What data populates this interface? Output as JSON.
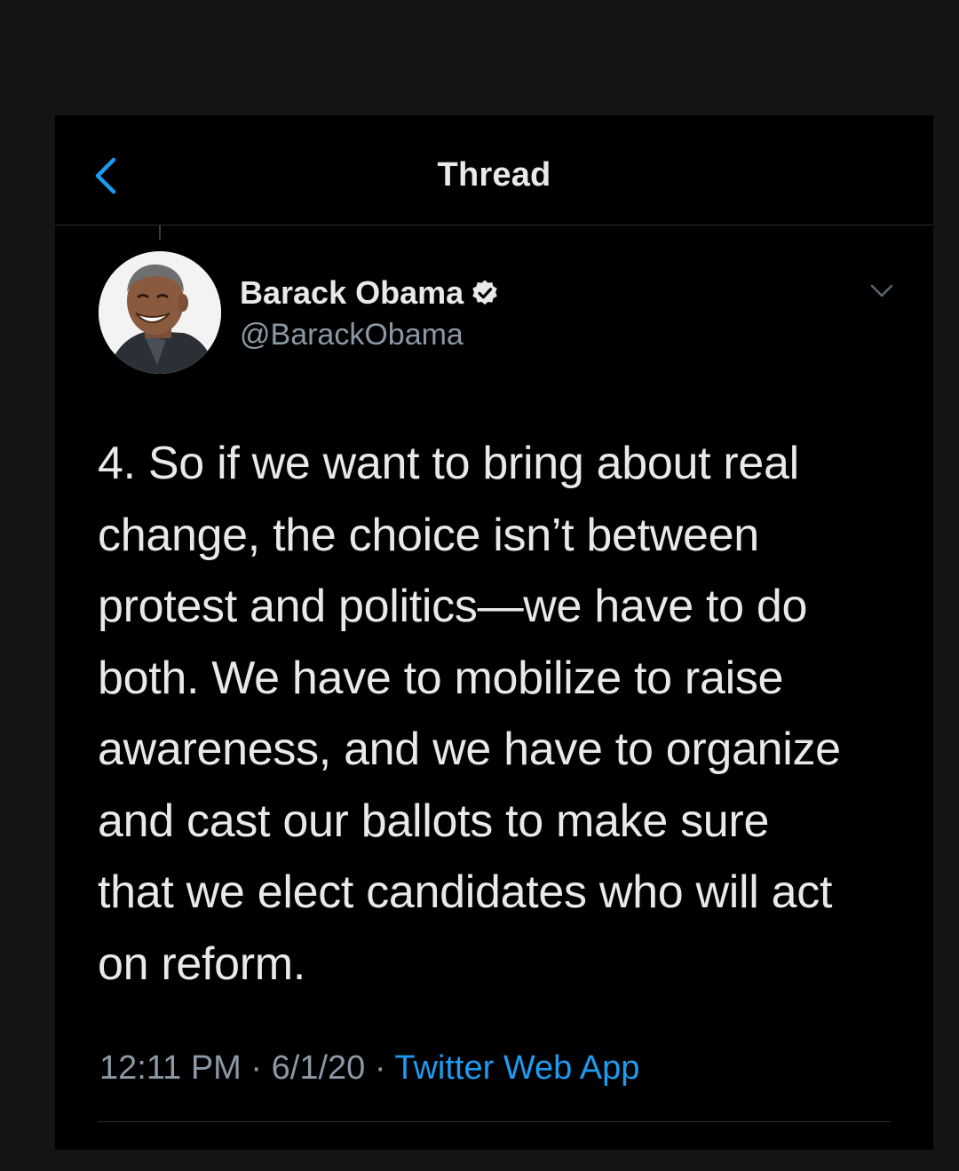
{
  "header": {
    "title": "Thread",
    "back_icon": "chevron-left-icon"
  },
  "tweet": {
    "author": {
      "display_name": "Barack Obama",
      "handle": "@BarackObama",
      "verified": true
    },
    "text": "4. So if we want to bring about real\nchange, the choice isn’t between\nprotest and politics—we have to do\nboth. We have to mobilize to raise\nawareness, and we have to organize\nand cast our ballots to make sure\nthat we elect candidates who will act\non reform.",
    "time": "12:11 PM",
    "date": "6/1/20",
    "separator": "·",
    "source": "Twitter Web App"
  },
  "colors": {
    "accent": "#1d9bf0",
    "background": "#000000",
    "text_primary": "#e7e9ea",
    "text_secondary": "#8b98a5"
  }
}
